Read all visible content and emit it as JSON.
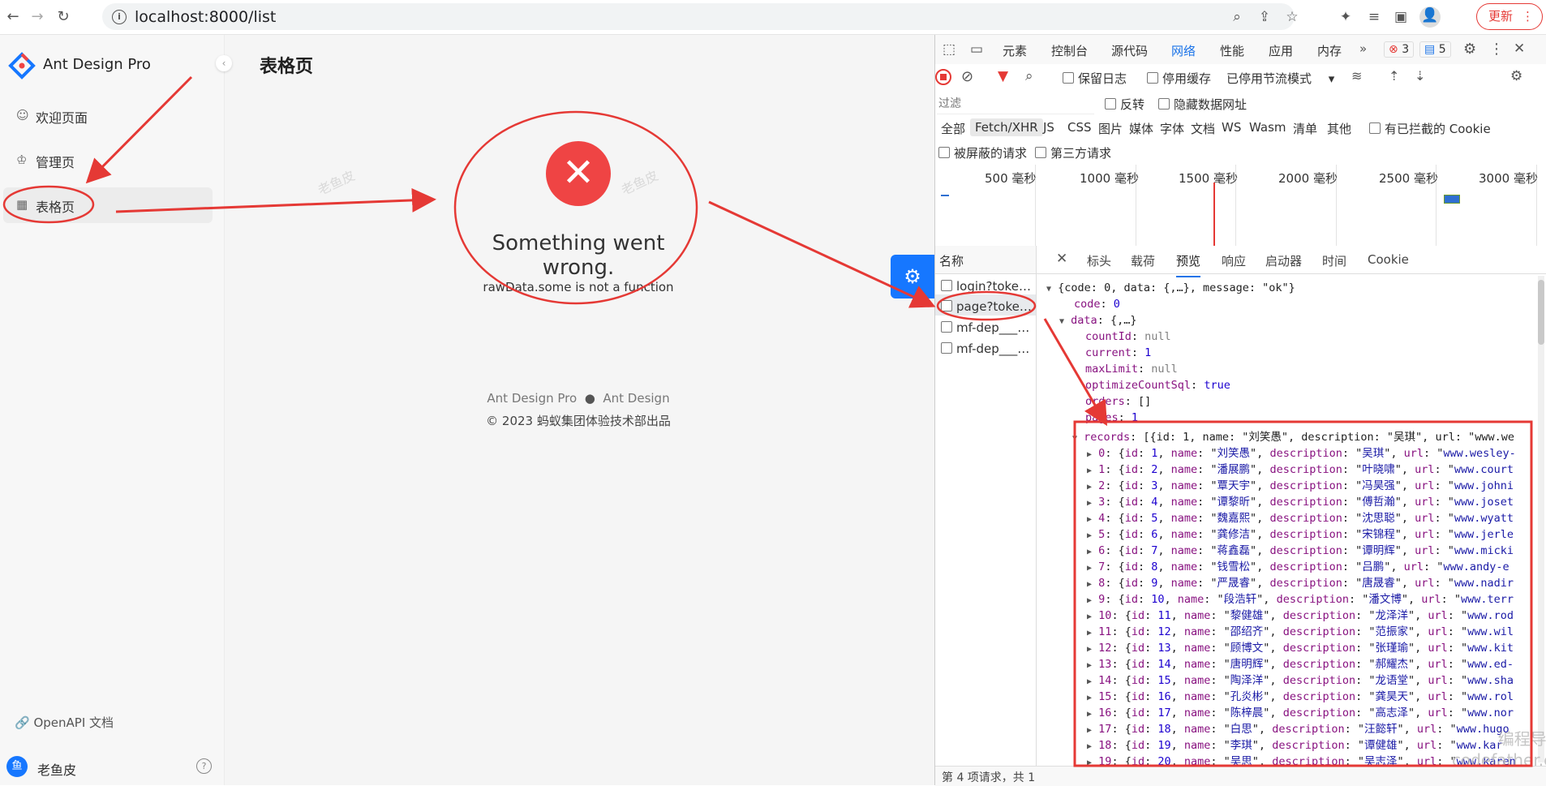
{
  "browser": {
    "url": "localhost:8000/list",
    "update_label": "更新"
  },
  "app": {
    "brand": "Ant Design Pro",
    "menu": [
      {
        "label": "欢迎页面",
        "icon": "smile-icon"
      },
      {
        "label": "管理页",
        "icon": "crown-icon"
      },
      {
        "label": "表格页",
        "icon": "table-icon"
      }
    ],
    "openapi_label": "OpenAPI 文档",
    "user_name": "老鱼皮",
    "user_avatar_text": "鱼",
    "page_title": "表格页",
    "error": {
      "title": "Something went wrong.",
      "message": "rawData.some is not a function"
    },
    "footer": {
      "link1": "Ant Design Pro",
      "link2": "Ant Design",
      "copyright": "2023 蚂蚁集团体验技术部出品"
    },
    "watermark": "老鱼皮"
  },
  "devtools": {
    "tabs": [
      "元素",
      "控制台",
      "源代码",
      "网络",
      "性能",
      "应用",
      "内存"
    ],
    "active_tab": "网络",
    "error_count": "3",
    "message_count": "5",
    "toolbar": {
      "preserve_log": "保留日志",
      "disable_cache": "停用缓存",
      "throttle": "已停用节流模式"
    },
    "filter": {
      "placeholder": "过滤",
      "invert": "反转",
      "hide_data_urls": "隐藏数据网址"
    },
    "type_filters": [
      "全部",
      "Fetch/XHR",
      "JS",
      "CSS",
      "图片",
      "媒体",
      "字体",
      "文档",
      "WS",
      "Wasm",
      "清单",
      "其他"
    ],
    "blocked_cookies": "有已拦截的 Cookie",
    "blocked_requests": "被屏蔽的请求",
    "third_party": "第三方请求",
    "timeline_ticks": [
      "500 毫秒",
      "1000 毫秒",
      "1500 毫秒",
      "2000 毫秒",
      "2500 毫秒",
      "3000 毫秒"
    ],
    "name_header": "名称",
    "requests": [
      "login?token...",
      "page?token...",
      "mf-dep____ve...",
      "mf-dep____ve..."
    ],
    "preview_tabs": [
      "标头",
      "载荷",
      "预览",
      "响应",
      "启动器",
      "时间",
      "Cookie"
    ],
    "active_preview_tab": "预览",
    "json": {
      "root": "{code: 0, data: {,…}, message: \"ok\"}",
      "code": "0",
      "data_summary": "{,…}",
      "countId": "null",
      "current": "1",
      "maxLimit": "null",
      "optimizeCountSql": "true",
      "orders": "[]",
      "pages": "1",
      "records_summary": "[{id: 1, name: \"刘笑愚\", description: \"吴琪\", url: \"www.we",
      "records": [
        {
          "idx": "0",
          "id": "1",
          "name": "刘笑愚",
          "desc": "吴琪",
          "url": "www.wesley-"
        },
        {
          "idx": "1",
          "id": "2",
          "name": "潘展鹏",
          "desc": "叶晓啸",
          "url": "www.court"
        },
        {
          "idx": "2",
          "id": "3",
          "name": "覃天宇",
          "desc": "冯昊强",
          "url": "www.johni"
        },
        {
          "idx": "3",
          "id": "4",
          "name": "谭黎昕",
          "desc": "傅哲瀚",
          "url": "www.joset"
        },
        {
          "idx": "4",
          "id": "5",
          "name": "魏嘉熙",
          "desc": "沈思聪",
          "url": "www.wyatt"
        },
        {
          "idx": "5",
          "id": "6",
          "name": "龚修洁",
          "desc": "宋锦程",
          "url": "www.jerle"
        },
        {
          "idx": "6",
          "id": "7",
          "name": "蒋鑫磊",
          "desc": "谭明辉",
          "url": "www.micki"
        },
        {
          "idx": "7",
          "id": "8",
          "name": "钱雪松",
          "desc": "吕鹏",
          "url": "www.andy-e"
        },
        {
          "idx": "8",
          "id": "9",
          "name": "严晟睿",
          "desc": "唐晟睿",
          "url": "www.nadir"
        },
        {
          "idx": "9",
          "id": "10",
          "name": "段浩轩",
          "desc": "潘文博",
          "url": "www.terr"
        },
        {
          "idx": "10",
          "id": "11",
          "name": "黎健雄",
          "desc": "龙泽洋",
          "url": "www.rod"
        },
        {
          "idx": "11",
          "id": "12",
          "name": "邵绍齐",
          "desc": "范振家",
          "url": "www.wil"
        },
        {
          "idx": "12",
          "id": "13",
          "name": "顾博文",
          "desc": "张瑾瑜",
          "url": "www.kit"
        },
        {
          "idx": "13",
          "id": "14",
          "name": "唐明辉",
          "desc": "郝耀杰",
          "url": "www.ed-"
        },
        {
          "idx": "14",
          "id": "15",
          "name": "陶泽洋",
          "desc": "龙语堂",
          "url": "www.sha"
        },
        {
          "idx": "15",
          "id": "16",
          "name": "孔炎彬",
          "desc": "龚昊天",
          "url": "www.rol"
        },
        {
          "idx": "16",
          "id": "17",
          "name": "陈梓晨",
          "desc": "高志泽",
          "url": "www.nor"
        },
        {
          "idx": "17",
          "id": "18",
          "name": "白思",
          "desc": "汪懿轩",
          "url": "www.hugo"
        },
        {
          "idx": "18",
          "id": "19",
          "name": "李琪",
          "desc": "谭健雄",
          "url": "www.kar"
        },
        {
          "idx": "19",
          "id": "20",
          "name": "吴思",
          "desc": "吴志泽",
          "url": "www.karen"
        }
      ],
      "searchCount": "true"
    },
    "status": "第 4 项请求，共 1",
    "corner_watermark_1": "编程导航",
    "corner_watermark_2": "codefather.cn"
  }
}
